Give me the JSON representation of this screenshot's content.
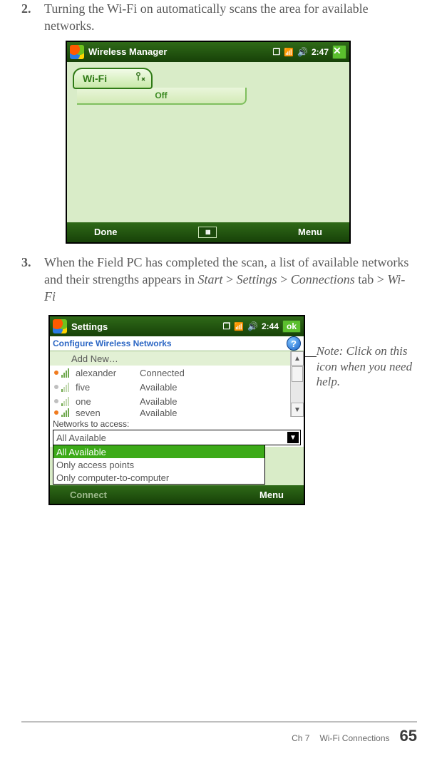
{
  "steps": {
    "s2": {
      "num": "2.",
      "text": "Turning the Wi-Fi on automatically scans the area for available networks."
    },
    "s3": {
      "num": "3.",
      "lead": "When the Field PC has completed the scan, a list of available networks and their strengths appears in ",
      "p1": "Start",
      "sep1": " > ",
      "p2": "Settings",
      "sep2": " > ",
      "p3": "Connections",
      "mid": " tab ",
      "sep3": "> ",
      "p4": "Wi-Fi"
    }
  },
  "wm": {
    "title": "Wireless Manager",
    "clock": "2:47",
    "close": "✕",
    "wifi_label": "Wi-Fi",
    "wifi_status": "Off",
    "soft_left": "Done",
    "soft_right": "Menu"
  },
  "cfg": {
    "topbar_title": "Settings",
    "clock": "2:44",
    "ok": "ok",
    "header": "Configure Wireless Networks",
    "help_glyph": "?",
    "rows": [
      {
        "name": "Add New…",
        "status": ""
      },
      {
        "name": "alexander",
        "status": "Connected"
      },
      {
        "name": "five",
        "status": "Available"
      },
      {
        "name": "one",
        "status": "Available"
      },
      {
        "name": "seven",
        "status": "Available"
      }
    ],
    "access_label": "Networks to access:",
    "dropdown": {
      "value": "All Available",
      "options": [
        "All Available",
        "Only access points",
        "Only computer-to-computer"
      ]
    },
    "soft_left": "Connect",
    "soft_right": "Menu",
    "scroll_up": "▲",
    "scroll_down": "▼"
  },
  "annotation": "Note: Click on this icon when you need help.",
  "footer": {
    "chapter": "Ch 7",
    "section": "Wi-Fi Connections",
    "page": "65"
  }
}
